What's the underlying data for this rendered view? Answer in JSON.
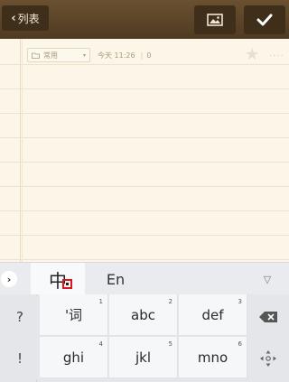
{
  "topbar": {
    "back_label": "列表",
    "back_icon": "chevron-left-icon",
    "image_icon": "image-icon",
    "done_icon": "checkmark-icon"
  },
  "note": {
    "folder": "常用",
    "timestamp": "今天 11:26",
    "separator": "|",
    "count": "0",
    "star_icon": "star-icon"
  },
  "keyboard": {
    "expand_icon": "chevron-right-icon",
    "mode_chinese": "中",
    "mode_english": "En",
    "collapse_icon": "triangle-down-icon",
    "side_keys": [
      "?",
      "!"
    ],
    "keys": [
      {
        "label": "'词",
        "num": "1"
      },
      {
        "label": "abc",
        "num": "2"
      },
      {
        "label": "def",
        "num": "3"
      },
      {
        "label": "ghi",
        "num": "4"
      },
      {
        "label": "jkl",
        "num": "5"
      },
      {
        "label": "mno",
        "num": "6"
      }
    ],
    "delete_icon": "backspace-icon",
    "move_icon": "cursor-move-icon"
  }
}
